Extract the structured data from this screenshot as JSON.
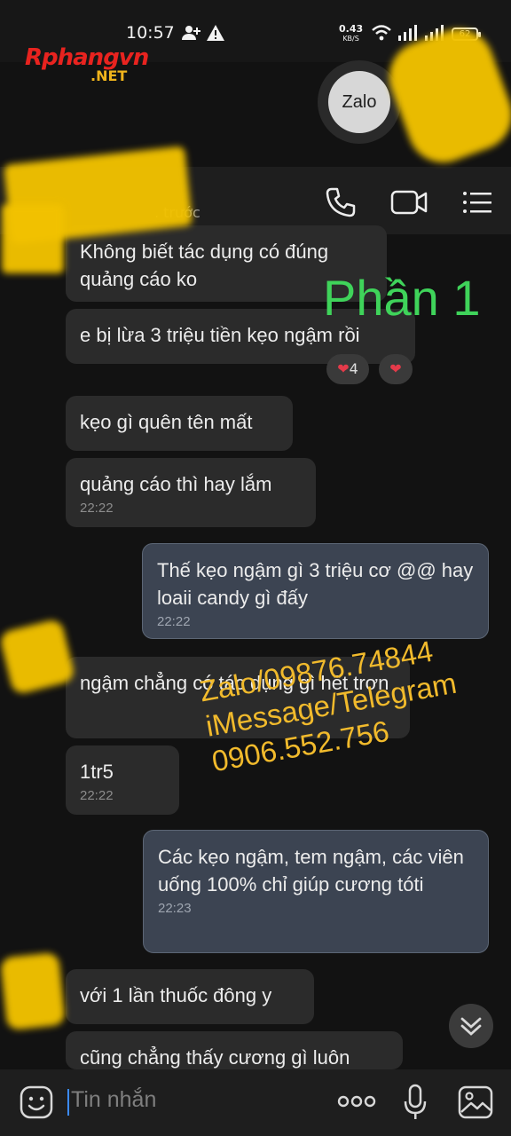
{
  "status_bar": {
    "time": "10:57",
    "speed_value": "0.43",
    "speed_unit": "KB/S",
    "battery": "62"
  },
  "watermark": {
    "logo_main": "Rphangvn",
    "logo_sub": ".NET",
    "overlay_title": "Phần 1",
    "contact_lines": [
      "Zalo/09876.74844",
      "iMessage/Telegram",
      "0906.552.756"
    ],
    "colors": {
      "title": "#3fd35a",
      "contact": "#f1ba2c"
    }
  },
  "app_badge": {
    "label": "Zalo"
  },
  "header": {
    "status_suffix": ". trước",
    "icons": [
      "phone-icon",
      "video-call-icon",
      "menu-icon"
    ]
  },
  "messages": [
    {
      "dir": "in",
      "text": "Không biết tác dụng có đúng quảng cáo ko"
    },
    {
      "dir": "in",
      "text": "e bị lừa 3 triệu tiền kẹo ngậm rồi"
    },
    {
      "dir": "in",
      "text": "kẹo gì quên tên mất"
    },
    {
      "dir": "in",
      "text": "quảng cáo thì hay lắm",
      "time": "22:22"
    },
    {
      "dir": "out",
      "text": "Thế kẹo ngậm gì 3 triệu cơ @@ hay loaii candy gì đấy",
      "time": "22:22"
    },
    {
      "dir": "in",
      "text": "ngậm chẳng có tác dụng gì hết trơn"
    },
    {
      "dir": "in",
      "text": "1tr5",
      "time": "22:22"
    },
    {
      "dir": "out",
      "text": "Các kẹo ngậm, tem ngậm, các viên uống 100% chỉ giúp cương tóti",
      "time": "22:23"
    },
    {
      "dir": "in",
      "text": "với 1 lần thuốc đông y"
    },
    {
      "dir": "in",
      "text": "cũng chẳng thấy cương gì luôn"
    }
  ],
  "reactions": {
    "count_label": "4"
  },
  "input": {
    "placeholder": "Tin nhắn"
  }
}
